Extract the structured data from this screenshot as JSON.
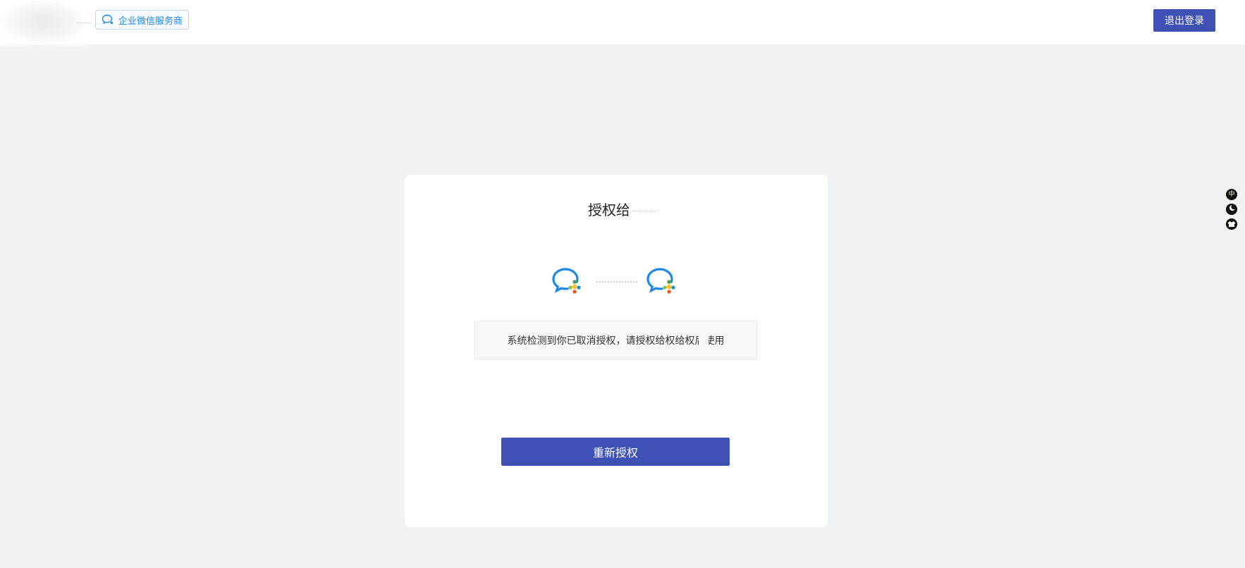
{
  "header": {
    "logo": "logo-icon",
    "badge": {
      "icon": "chat-bubble-icon",
      "text": "企业微信服务商",
      "color": "#1e88e5"
    },
    "logout_label": "退出登录"
  },
  "card": {
    "title": "授权给给",
    "icons": [
      "wecom-logo-icon",
      "wecom-logo-icon"
    ],
    "message": "系统检测到你已取消授权，请授权给权给权后使用",
    "button_label": "重新授权"
  },
  "side_tools": {
    "items": [
      {
        "icon": "language-icon",
        "label": "中"
      },
      {
        "icon": "moon-icon",
        "label": ""
      },
      {
        "icon": "shirt-icon",
        "label": ""
      }
    ]
  },
  "colors": {
    "primary": "#3f51b5",
    "background": "#f0f2f5",
    "accent_blue": "#1e88e5"
  }
}
